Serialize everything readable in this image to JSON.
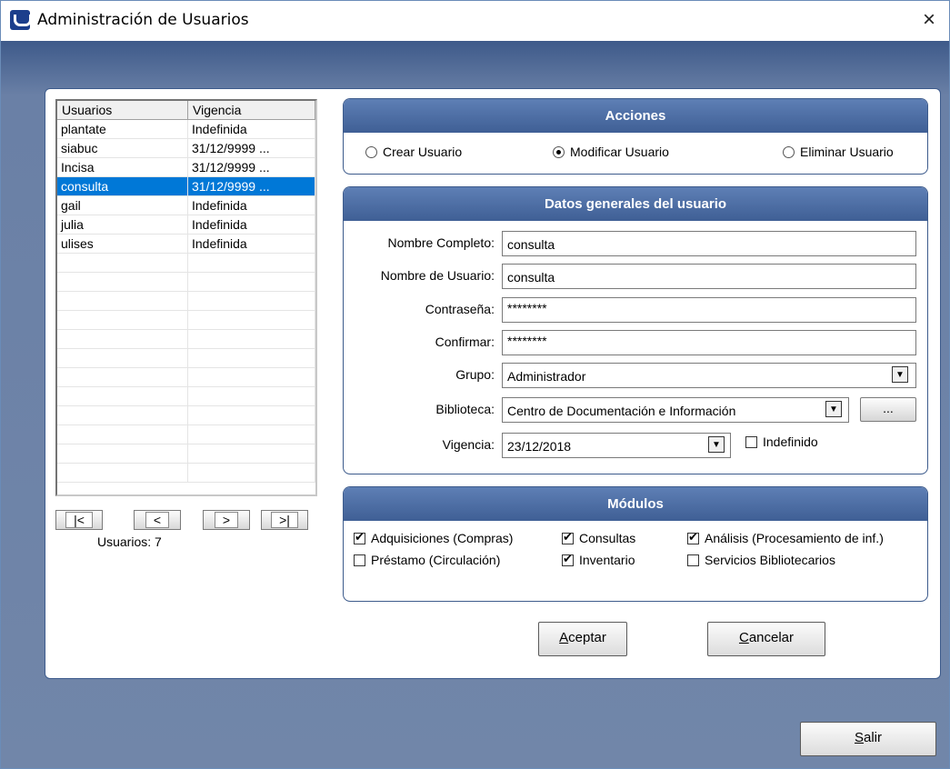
{
  "window": {
    "title": "Administración de Usuarios",
    "close_glyph": "×"
  },
  "users_grid": {
    "columns": [
      "Usuarios",
      "Vigencia"
    ],
    "rows": [
      {
        "user": "plantate",
        "vigencia": "Indefinida"
      },
      {
        "user": "siabuc",
        "vigencia": "31/12/9999 ..."
      },
      {
        "user": "Incisa",
        "vigencia": "31/12/9999 ..."
      },
      {
        "user": "consulta",
        "vigencia": "31/12/9999 ...",
        "selected": true
      },
      {
        "user": "gail",
        "vigencia": "Indefinida"
      },
      {
        "user": "julia",
        "vigencia": "Indefinida"
      },
      {
        "user": "ulises",
        "vigencia": "Indefinida"
      }
    ],
    "empty_rows": 12
  },
  "nav": {
    "first": "|<",
    "prev": "<",
    "next": ">",
    "last": ">|",
    "count_label": "Usuarios:",
    "count_value": "7"
  },
  "acciones": {
    "title": "Acciones",
    "options": [
      {
        "label": "Crear Usuario",
        "selected": false
      },
      {
        "label": "Modificar Usuario",
        "selected": true
      },
      {
        "label": "Eliminar Usuario",
        "selected": false
      }
    ]
  },
  "datos": {
    "title": "Datos generales del usuario",
    "nombre_completo_label": "Nombre Completo:",
    "nombre_completo_value": "consulta",
    "nombre_usuario_label": "Nombre de Usuario:",
    "nombre_usuario_value": "consulta",
    "contrasena_label": "Contraseña:",
    "contrasena_value": "********",
    "confirmar_label": "Confirmar:",
    "confirmar_value": "********",
    "grupo_label": "Grupo:",
    "grupo_value": "Administrador",
    "biblioteca_label": "Biblioteca:",
    "biblioteca_value": "Centro de Documentación e Información",
    "biblioteca_button": "...",
    "vigencia_label": "Vigencia:",
    "vigencia_value": "23/12/2018",
    "indefinido_label": "Indefinido",
    "indefinido_checked": false
  },
  "modulos": {
    "title": "Módulos",
    "items": [
      {
        "label": "Adquisiciones (Compras)",
        "checked": true
      },
      {
        "label": "Consultas",
        "checked": true
      },
      {
        "label": "Análisis (Procesamiento de inf.)",
        "checked": true
      },
      {
        "label": "Préstamo (Circulación)",
        "checked": false
      },
      {
        "label": "Inventario",
        "checked": true
      },
      {
        "label": "Servicios Bibliotecarios",
        "checked": false
      }
    ]
  },
  "buttons": {
    "aceptar_hotkey": "A",
    "aceptar_rest": "ceptar",
    "cancelar_hotkey": "C",
    "cancelar_rest": "ancelar",
    "salir_hotkey": "S",
    "salir_rest": "alir"
  }
}
